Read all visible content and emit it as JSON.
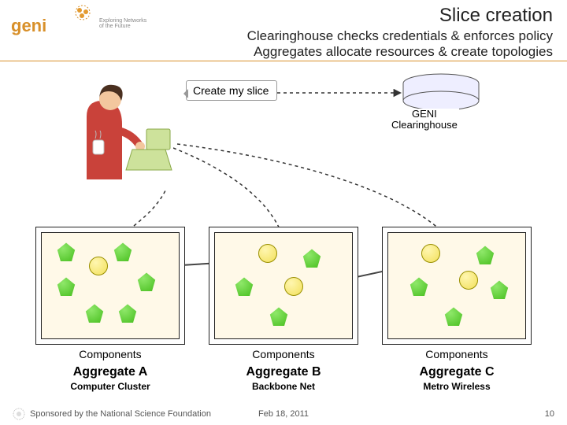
{
  "header": {
    "title": "Slice creation",
    "subtitle_line1": "Clearinghouse checks credentials & enforces policy",
    "subtitle_line2": "Aggregates allocate resources & create topologies",
    "logo_tag1": "Exploring Networks",
    "logo_tag2": "of the Future"
  },
  "diagram": {
    "speech": "Create my slice",
    "clearinghouse_label_line1": "GENI",
    "clearinghouse_label_line2": "Clearinghouse",
    "components_label": "Components",
    "aggregates": [
      {
        "title": "Aggregate A",
        "subtitle": "Computer Cluster"
      },
      {
        "title": "Aggregate B",
        "subtitle": "Backbone Net"
      },
      {
        "title": "Aggregate C",
        "subtitle": "Metro Wireless"
      }
    ]
  },
  "footer": {
    "sponsor": "Sponsored by the National Science Foundation",
    "date": "Feb 18, 2011",
    "page": "10"
  },
  "colors": {
    "accent_rule": "#d8902a",
    "node_green": "#3fb915",
    "node_yellow": "#f2e05a",
    "panel_bg": "#fff9e8"
  }
}
